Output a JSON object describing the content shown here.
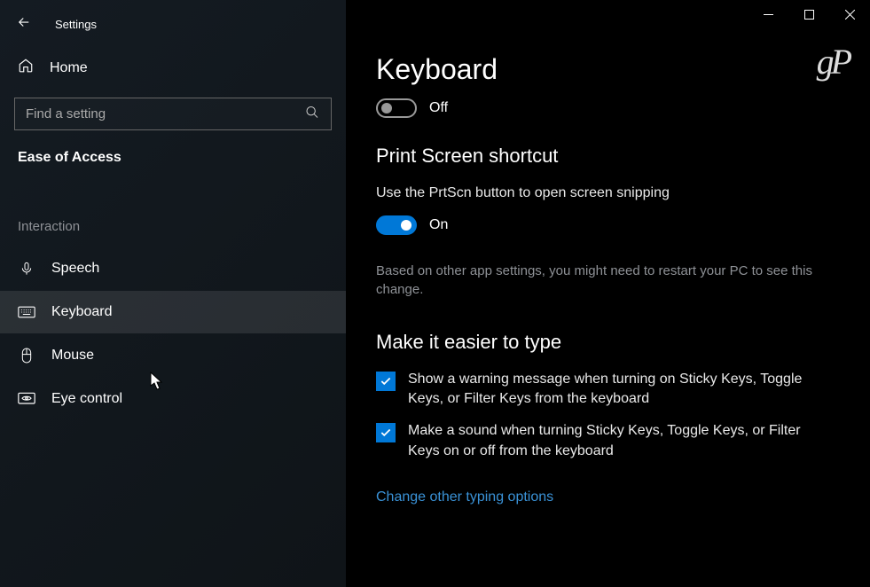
{
  "app_title": "Settings",
  "watermark": "gP",
  "sidebar": {
    "home_label": "Home",
    "search_placeholder": "Find a setting",
    "category": "Ease of Access",
    "group": "Interaction",
    "items": [
      {
        "label": "Speech"
      },
      {
        "label": "Keyboard"
      },
      {
        "label": "Mouse"
      },
      {
        "label": "Eye control"
      }
    ]
  },
  "main": {
    "title": "Keyboard",
    "main_toggle_label": "Off",
    "section1": {
      "heading": "Print Screen shortcut",
      "desc": "Use the PrtScn button to open screen snipping",
      "toggle_label": "On",
      "note": "Based on other app settings, you might need to restart your PC to see this change."
    },
    "section2": {
      "heading": "Make it easier to type",
      "opt1": "Show a warning message when turning on Sticky Keys, Toggle Keys, or Filter Keys from the keyboard",
      "opt2": "Make a sound when turning Sticky Keys, Toggle Keys, or Filter Keys on or off from the keyboard",
      "link": "Change other typing options"
    }
  }
}
